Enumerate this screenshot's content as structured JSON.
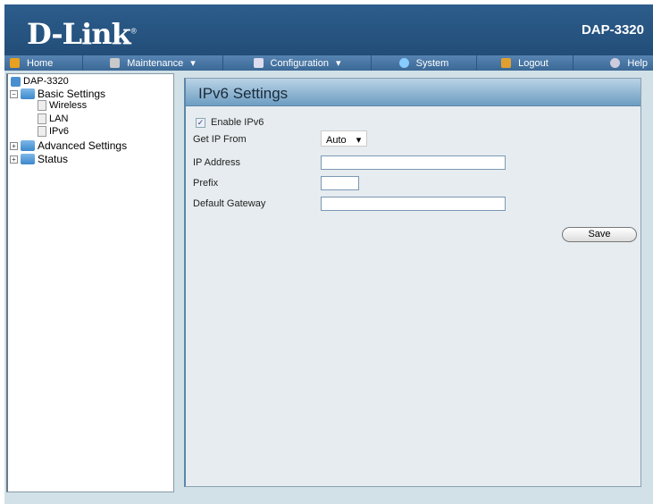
{
  "header": {
    "brand": "D-Link",
    "model": "DAP-3320"
  },
  "nav": [
    {
      "label": "Home",
      "icon": "home-icon"
    },
    {
      "label": "Maintenance",
      "icon": "tools-icon",
      "dropdown": true
    },
    {
      "label": "Configuration",
      "icon": "save-disk-icon",
      "dropdown": true
    },
    {
      "label": "System",
      "icon": "system-icon"
    },
    {
      "label": "Logout",
      "icon": "key-icon"
    },
    {
      "label": "Help",
      "icon": "help-icon"
    }
  ],
  "tree": {
    "root": "DAP-3320",
    "basic": "Basic Settings",
    "wireless": "Wireless",
    "lan": "LAN",
    "ipv6": "IPv6",
    "advanced": "Advanced Settings",
    "status": "Status"
  },
  "form": {
    "title": "IPv6 Settings",
    "enable_label": "Enable IPv6",
    "enabled": true,
    "get_ip_label": "Get IP From",
    "get_ip_value": "Auto",
    "ip_label": "IP Address",
    "ip_value": "",
    "prefix_label": "Prefix",
    "prefix_value": "",
    "gateway_label": "Default Gateway",
    "gateway_value": "",
    "save": "Save"
  }
}
